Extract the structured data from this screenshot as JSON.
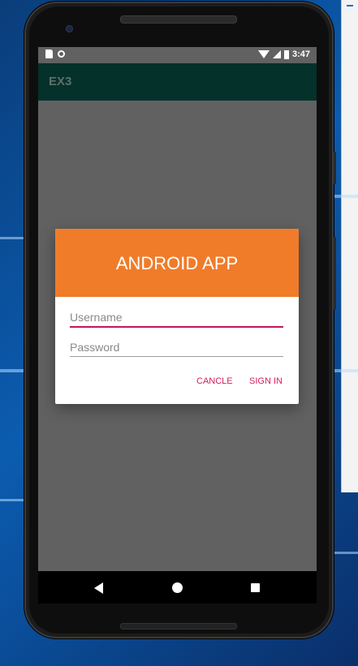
{
  "status_bar": {
    "time": "3:47",
    "icons": [
      "sd-card-icon",
      "circle-icon",
      "wifi-icon",
      "signal-icon",
      "battery-icon"
    ]
  },
  "toolbar": {
    "title": "EX3"
  },
  "dialog": {
    "title": "ANDROID APP",
    "username_placeholder": "Username",
    "password_placeholder": "Password",
    "username_value": "",
    "password_value": "",
    "cancel_label": "CANCLE",
    "signin_label": "SIGN IN"
  },
  "nav_bar": {
    "icons": [
      "back-icon",
      "home-icon",
      "recents-icon"
    ]
  },
  "colors": {
    "dialog_header": "#f07c2a",
    "accent": "#d81b60",
    "toolbar": "#04312a",
    "screen_dim": "#616161"
  }
}
